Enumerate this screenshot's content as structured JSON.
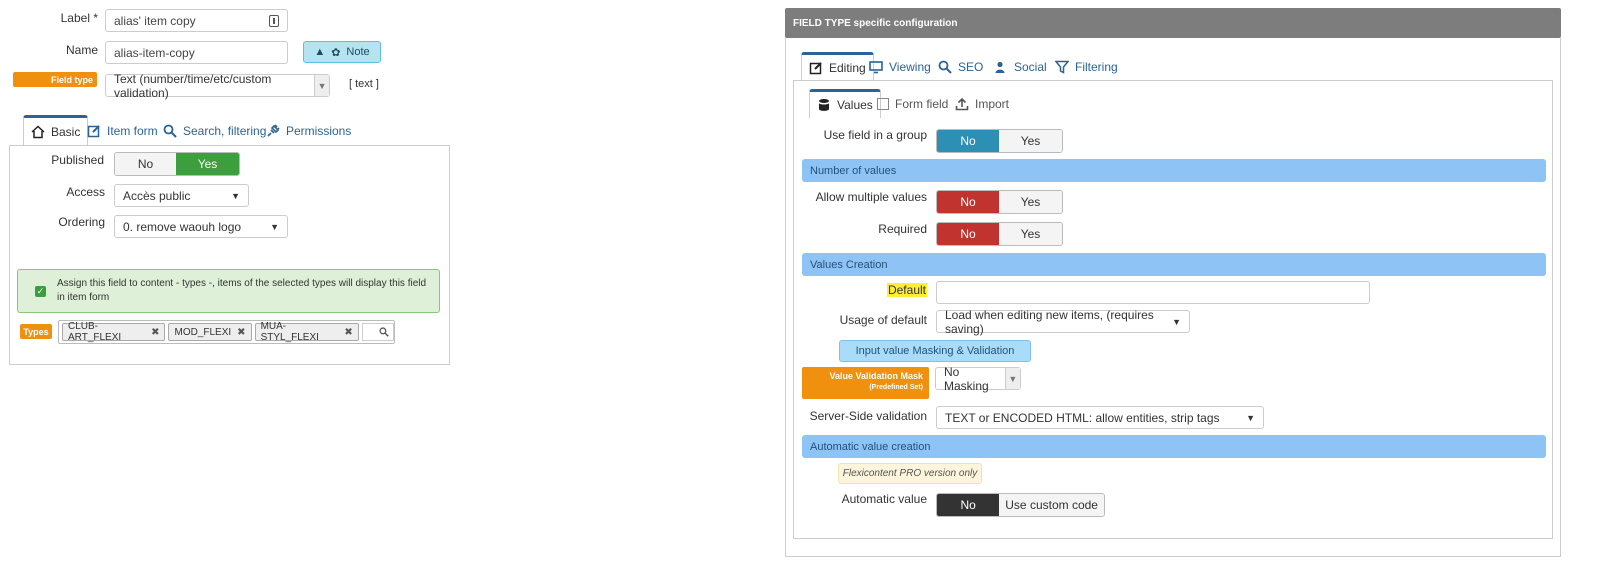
{
  "left": {
    "label_field": {
      "label": "Label *",
      "value": "alias' item copy"
    },
    "name_field": {
      "label": "Name",
      "value": "alias-item-copy"
    },
    "note_button": {
      "label": "Note"
    },
    "field_type": {
      "badge": "Field type",
      "value": "Text (number/time/etc/custom validation)",
      "code": "[ text ]"
    },
    "tabs": [
      {
        "label": "Basic",
        "icon": "home-icon"
      },
      {
        "label": "Item form",
        "icon": "edit-icon"
      },
      {
        "label": "Search, filtering",
        "icon": "search-icon"
      },
      {
        "label": "Permissions",
        "icon": "plug-icon"
      }
    ],
    "published": {
      "label": "Published",
      "no": "No",
      "yes": "Yes",
      "selected": "Yes"
    },
    "access": {
      "label": "Access",
      "value": "Accès public"
    },
    "ordering": {
      "label": "Ordering",
      "value": "0. remove waouh logo"
    },
    "assign_notice": {
      "line1": "Assign this field to content - types -, items of the selected types will display this field",
      "line2": "in item form",
      "checked": true
    },
    "types": {
      "badge": "Types",
      "chips": [
        "CLUB-ART_FLEXI",
        "MOD_FLEXI",
        "MUA-STYL_FLEXI"
      ]
    }
  },
  "right": {
    "header": "FIELD TYPE specific configuration",
    "tabs": [
      {
        "label": "Editing",
        "icon": "edit-icon"
      },
      {
        "label": "Viewing",
        "icon": "monitor-icon"
      },
      {
        "label": "SEO",
        "icon": "search-icon"
      },
      {
        "label": "Social",
        "icon": "users-icon"
      },
      {
        "label": "Filtering",
        "icon": "filter-icon"
      }
    ],
    "subtabs": [
      {
        "label": "Values",
        "icon": "database-icon"
      },
      {
        "label": "Form field",
        "icon": "checkbox-icon"
      },
      {
        "label": "Import",
        "icon": "upload-icon"
      }
    ],
    "use_group": {
      "label": "Use field in a group",
      "no": "No",
      "yes": "Yes",
      "selected": "No"
    },
    "sections": {
      "number_of_values": "Number of values",
      "values_creation": "Values Creation",
      "automatic_value_creation": "Automatic value creation"
    },
    "allow_multiple": {
      "label": "Allow multiple values",
      "no": "No",
      "yes": "Yes",
      "selected": "No"
    },
    "required": {
      "label": "Required",
      "no": "No",
      "yes": "Yes",
      "selected": "No"
    },
    "default": {
      "label": "Default",
      "value": ""
    },
    "usage_default": {
      "label": "Usage of default",
      "value": "Load when editing new items, (requires saving)"
    },
    "masking_button": "Input value Masking & Validation",
    "validation_mask": {
      "title": "Value Validation Mask",
      "subtitle": "(Predefined Set)",
      "value": "No Masking"
    },
    "server_validation": {
      "label": "Server-Side validation",
      "value": "TEXT or ENCODED HTML: allow entities, strip tags"
    },
    "pro_note": "Flexicontent PRO version only",
    "automatic_value": {
      "label": "Automatic value",
      "no": "No",
      "custom": "Use custom code",
      "selected": "No"
    }
  },
  "colors": {
    "orange": "#f0900f",
    "green": "#3c9e3c",
    "red": "#c0332e",
    "teal": "#2e8fb5",
    "dark": "#333333",
    "section_blue": "#8dc4f5",
    "header_gray": "#7d7d7d"
  }
}
